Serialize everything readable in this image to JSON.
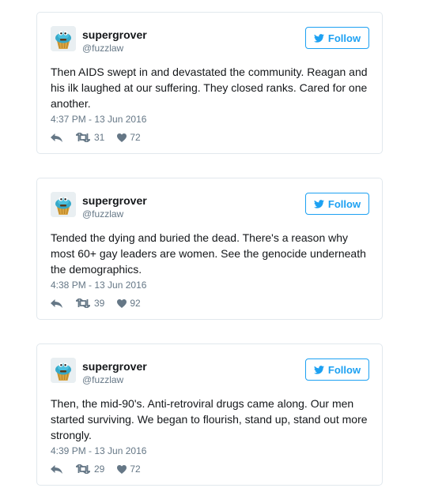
{
  "tweets": [
    {
      "user": {
        "name": "supergrover",
        "handle": "@fuzzlaw"
      },
      "follow_label": "Follow",
      "text": "Then AIDS swept in and devastated the community. Reagan and his ilk laughed at our suffering. They closed ranks. Cared for one another.",
      "timestamp": "4:37 PM - 13 Jun 2016",
      "retweets": "31",
      "likes": "72"
    },
    {
      "user": {
        "name": "supergrover",
        "handle": "@fuzzlaw"
      },
      "follow_label": "Follow",
      "text": "Tended the dying and buried the dead. There's a reason why most 60+ gay leaders are women. See the genocide underneath the demographics.",
      "timestamp": "4:38 PM - 13 Jun 2016",
      "retweets": "39",
      "likes": "92"
    },
    {
      "user": {
        "name": "supergrover",
        "handle": "@fuzzlaw"
      },
      "follow_label": "Follow",
      "text": "Then, the mid-90's. Anti-retroviral drugs came along. Our men started surviving. We began to flourish, stand up, stand out more strongly.",
      "timestamp": "4:39 PM - 13 Jun 2016",
      "retweets": "29",
      "likes": "72"
    }
  ],
  "icons": {
    "follow": "twitter-bird-icon",
    "reply": "reply-icon",
    "retweet": "retweet-icon",
    "like": "heart-icon",
    "avatar": "cupcake-avatar"
  },
  "colors": {
    "accent": "#1da1f2",
    "secondary_text": "#657786",
    "border": "#e1e8ed"
  }
}
